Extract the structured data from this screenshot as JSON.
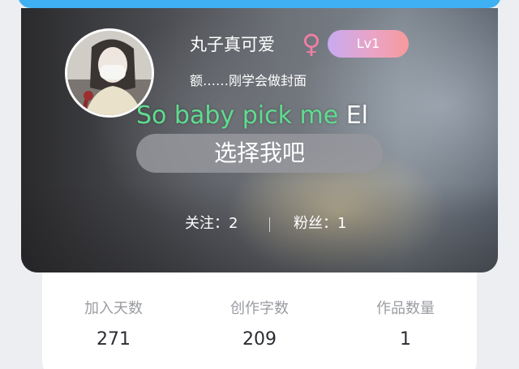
{
  "profile": {
    "nickname": "丸子真可爱",
    "gender_icon": "female-symbol-icon",
    "gender_symbol": "♀",
    "level": "Lv1",
    "signature": "额……刚学会做封面"
  },
  "lyric": {
    "highlighted": "So baby pick me",
    "rest": " El"
  },
  "select_button": {
    "label": "选择我吧"
  },
  "follow": {
    "following_text": "关注：2",
    "fans_text": "粉丝：1"
  },
  "stats": [
    {
      "label": "加入天数",
      "value": "271"
    },
    {
      "label": "创作字数",
      "value": "209"
    },
    {
      "label": "作品数量",
      "value": "1"
    }
  ],
  "colors": {
    "top_bar": "#3fb0f2",
    "lyric_highlight": "#5fdc8f",
    "gender": "#f07fa2",
    "level_badge_start": "#c8aaf0",
    "level_badge_end": "#f79a9c"
  }
}
